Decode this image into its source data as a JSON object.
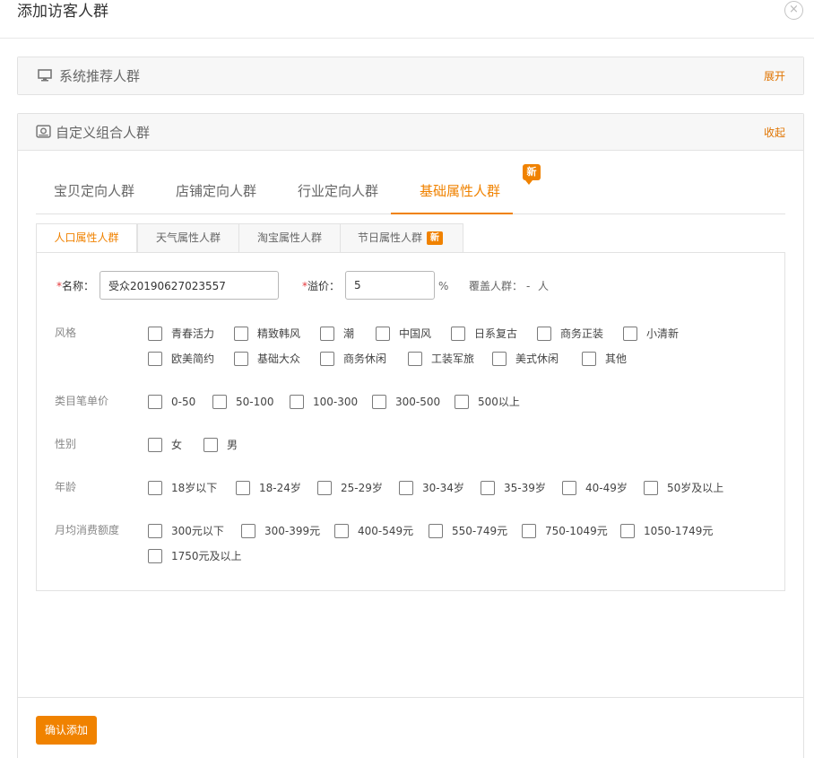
{
  "dialog": {
    "title": "添加访客人群",
    "close_icon": "×"
  },
  "system_panel": {
    "icon": "monitor-icon",
    "title": "系统推荐人群",
    "toggle": "展开"
  },
  "custom_panel": {
    "icon": "target-box-icon",
    "title": "自定义组合人群",
    "toggle": "收起"
  },
  "main_tabs": [
    {
      "label": "宝贝定向人群"
    },
    {
      "label": "店铺定向人群"
    },
    {
      "label": "行业定向人群"
    },
    {
      "label": "基础属性人群",
      "badge": "新",
      "active": true
    }
  ],
  "sub_tabs": [
    {
      "label": "人口属性人群",
      "active": true
    },
    {
      "label": "天气属性人群"
    },
    {
      "label": "淘宝属性人群"
    },
    {
      "label": "节日属性人群",
      "badge": "新"
    }
  ],
  "form": {
    "name_required": "*",
    "name_label": "名称：",
    "name_value": "受众20190627023557",
    "premium_required": "*",
    "premium_label": "溢价：",
    "premium_value": "5",
    "premium_unit": "%",
    "coverage_label": "覆盖人群：",
    "coverage_value": "-",
    "coverage_unit": "人"
  },
  "attribute_rows": [
    {
      "label": "风格",
      "options": [
        "青春活力",
        "精致韩风",
        "潮",
        "中国风",
        "日系复古",
        "商务正装",
        "小清新",
        "欧美简约",
        "基础大众",
        "商务休闲",
        "工装军旅",
        "美式休闲",
        "其他"
      ]
    },
    {
      "label": "类目笔单价",
      "options": [
        "0-50",
        "50-100",
        "100-300",
        "300-500",
        "500以上"
      ]
    },
    {
      "label": "性别",
      "options": [
        "女",
        "男"
      ]
    },
    {
      "label": "年龄",
      "options": [
        "18岁以下",
        "18-24岁",
        "25-29岁",
        "30-34岁",
        "35-39岁",
        "40-49岁",
        "50岁及以上"
      ]
    },
    {
      "label": "月均消费额度",
      "options": [
        "300元以下",
        "300-399元",
        "400-549元",
        "550-749元",
        "750-1049元",
        "1050-1749元",
        "1750元及以上"
      ]
    }
  ],
  "submit_label": "确认添加",
  "colors": {
    "accent": "#f08200",
    "required": "#e4393c",
    "border": "#e2e2e2"
  }
}
